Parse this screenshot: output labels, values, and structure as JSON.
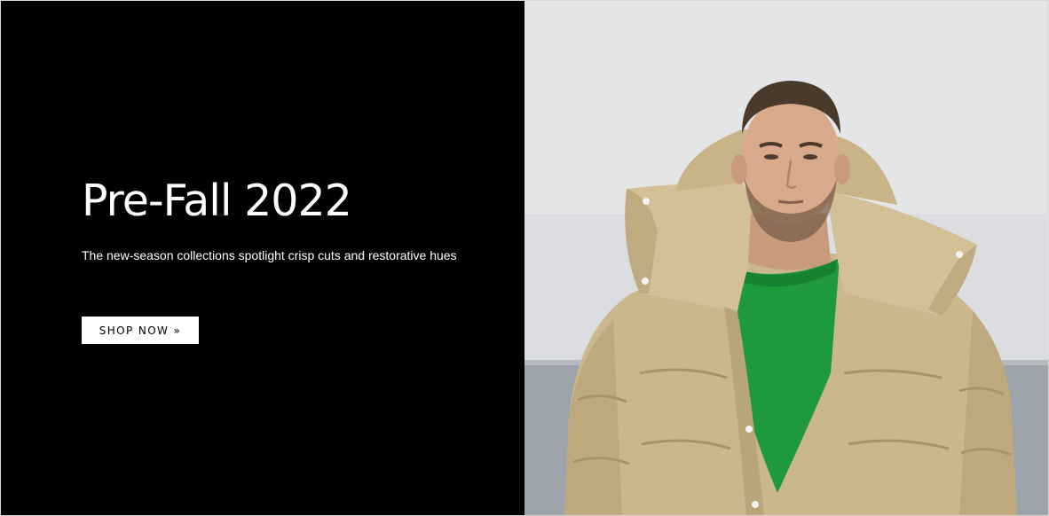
{
  "hero": {
    "title": "Pre-Fall 2022",
    "subtitle": "The new-season collections spotlight crisp cuts and restorative hues",
    "cta_label": "SHOP NOW »",
    "image_icon": "man-in-oversized-beige-puffer-jacket-photo"
  },
  "colors": {
    "panel_background": "#000000",
    "text": "#ffffff",
    "button_background": "#ffffff",
    "button_text": "#000000",
    "sky": "#e6e7e8",
    "jacket": "#cdb98f",
    "sweater": "#1f9a3a"
  }
}
